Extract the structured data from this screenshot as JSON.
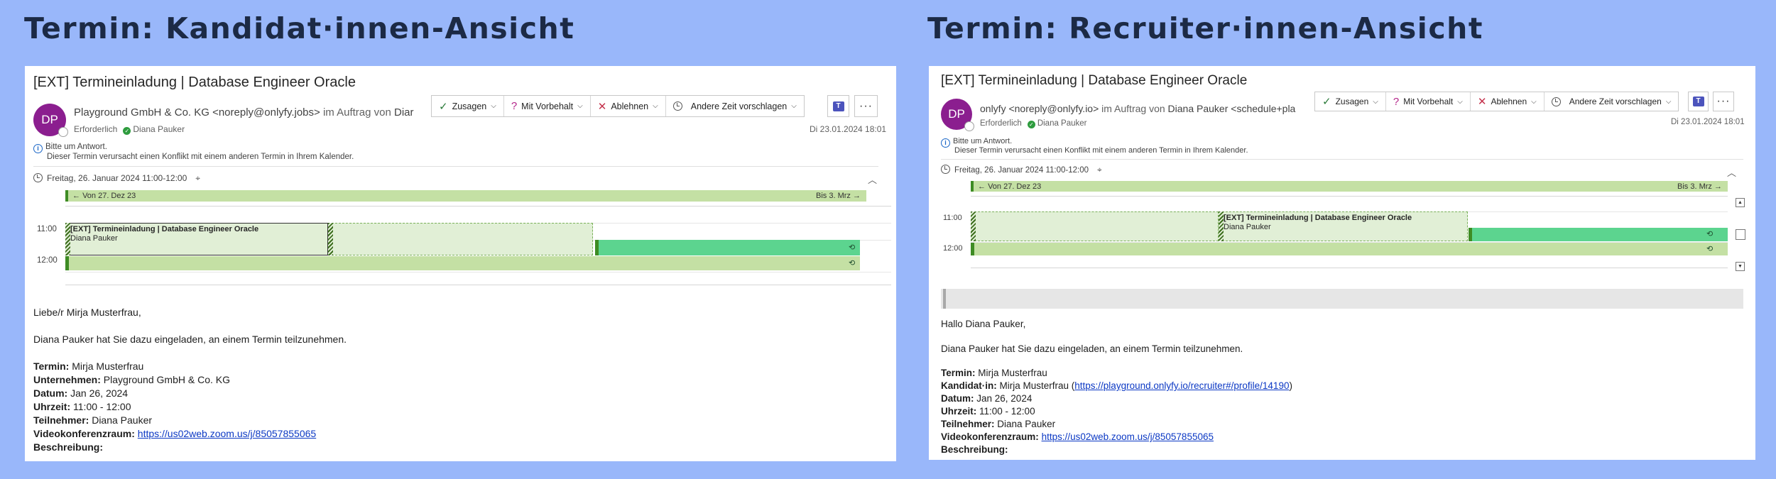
{
  "left": {
    "heading": "Termin: Kandidat·innen-Ansicht",
    "subject": "[EXT] Termineinladung | Database Engineer Oracle",
    "avatar_initials": "DP",
    "sender_name": "Playground GmbH & Co. KG <noreply@onlyfy.jobs>",
    "sender_on_behalf": "im Auftrag von",
    "sender_behalf_name": "Diar",
    "required_label": "Erforderlich",
    "attendee": "Diana Pauker",
    "sent_date": "Di 23.01.2024 18:01",
    "info_line1": "Bitte um Antwort.",
    "info_line2": "Dieser Termin verursacht einen Konflikt mit einem anderen Termin in Ihrem Kalender.",
    "when": "Freitag, 26. Januar 2024 11:00-12:00",
    "range_from": "Von 27. Dez 23",
    "range_to": "Bis 3. Mrz",
    "time_11": "11:00",
    "time_12": "12:00",
    "event_title": "[EXT] Termineinladung | Database Engineer Oracle",
    "event_person": "Diana Pauker",
    "greeting": "Liebe/r Mirja Musterfrau,",
    "invite_text": "Diana Pauker hat Sie dazu eingeladen, an einem Termin teilzunehmen.",
    "details": {
      "termin_label": "Termin:",
      "termin_value": "Mirja Musterfrau",
      "company_label": "Unternehmen:",
      "company_value": "Playground GmbH & Co. KG",
      "date_label": "Datum:",
      "date_value": "Jan 26, 2024",
      "time_label": "Uhrzeit:",
      "time_value": "11:00 - 12:00",
      "participant_label": "Teilnehmer:",
      "participant_value": "Diana Pauker",
      "video_label": "Videokonferenzraum:",
      "video_url": "https://us02web.zoom.us/j/85057855065",
      "desc_label": "Beschreibung:"
    }
  },
  "right": {
    "heading": "Termin: Recruiter·innen-Ansicht",
    "subject": "[EXT] Termineinladung | Database Engineer Oracle",
    "avatar_initials": "DP",
    "sender_name": "onlyfy <noreply@onlyfy.io>",
    "sender_on_behalf": "im Auftrag von",
    "sender_behalf_name": "Diana Pauker <schedule+pla",
    "required_label": "Erforderlich",
    "attendee": "Diana Pauker",
    "sent_date": "Di 23.01.2024 18:01",
    "info_line1": "Bitte um Antwort.",
    "info_line2": "Dieser Termin verursacht einen Konflikt mit einem anderen Termin in Ihrem Kalender.",
    "when": "Freitag, 26. Januar 2024 11:00-12:00",
    "range_from": "Von 27. Dez 23",
    "range_to": "Bis 3. Mrz",
    "time_11": "11:00",
    "time_12": "12:00",
    "event_title": "[EXT] Termineinladung | Database Engineer Oracle",
    "event_person": "Diana Pauker",
    "greeting": "Hallo Diana Pauker,",
    "invite_text": "Diana Pauker hat Sie dazu eingeladen, an einem Termin teilzunehmen.",
    "details": {
      "termin_label": "Termin:",
      "termin_value": "Mirja Musterfrau",
      "candidate_label": "Kandidat·in:",
      "candidate_value": "Mirja Musterfrau (",
      "candidate_url": "https://playground.onlyfy.io/recruiter#/profile/14190",
      "candidate_close": ")",
      "date_label": "Datum:",
      "date_value": "Jan 26, 2024",
      "time_label": "Uhrzeit:",
      "time_value": "11:00 - 12:00",
      "participant_label": "Teilnehmer:",
      "participant_value": "Diana Pauker",
      "video_label": "Videokonferenzraum:",
      "video_url": "https://us02web.zoom.us/j/85057855065",
      "desc_label": "Beschreibung:"
    }
  },
  "toolbar": {
    "accept": "Zusagen",
    "tentative": "Mit Vorbehalt",
    "decline": "Ablehnen",
    "propose": "Andere Zeit vorschlagen"
  },
  "colors": {
    "background": "#99b7fa",
    "avatar": "#8b1e8f",
    "busy": "#5cd48f",
    "event": "#e1efd6",
    "range": "#c4e0a4"
  }
}
